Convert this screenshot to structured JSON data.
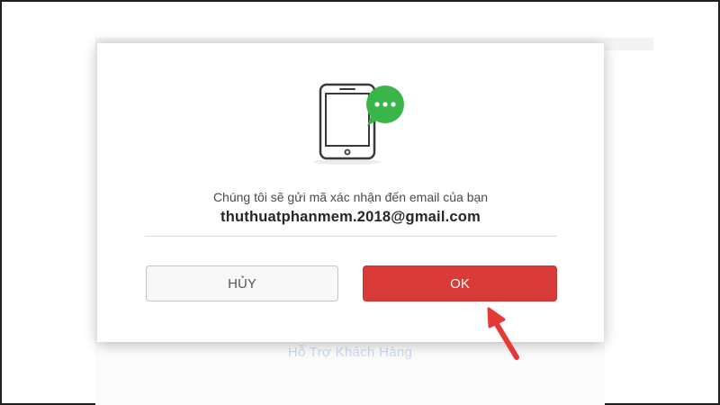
{
  "background": {
    "support_link": "Hỗ Trợ Khách Hàng"
  },
  "dialog": {
    "illustration_icon": "phone-with-chat-bubble-icon",
    "message": "Chúng tôi sẽ gửi mã xác nhận đến email của bạn",
    "email": "thuthuatphanmem.2018@gmail.com",
    "cancel_label": "HỦY",
    "ok_label": "OK"
  },
  "annotation": {
    "arrow_icon": "red-arrow-pointer-icon"
  },
  "colors": {
    "ok_button": "#d73a37",
    "chat_bubble": "#39b54a",
    "arrow": "#e53935"
  }
}
